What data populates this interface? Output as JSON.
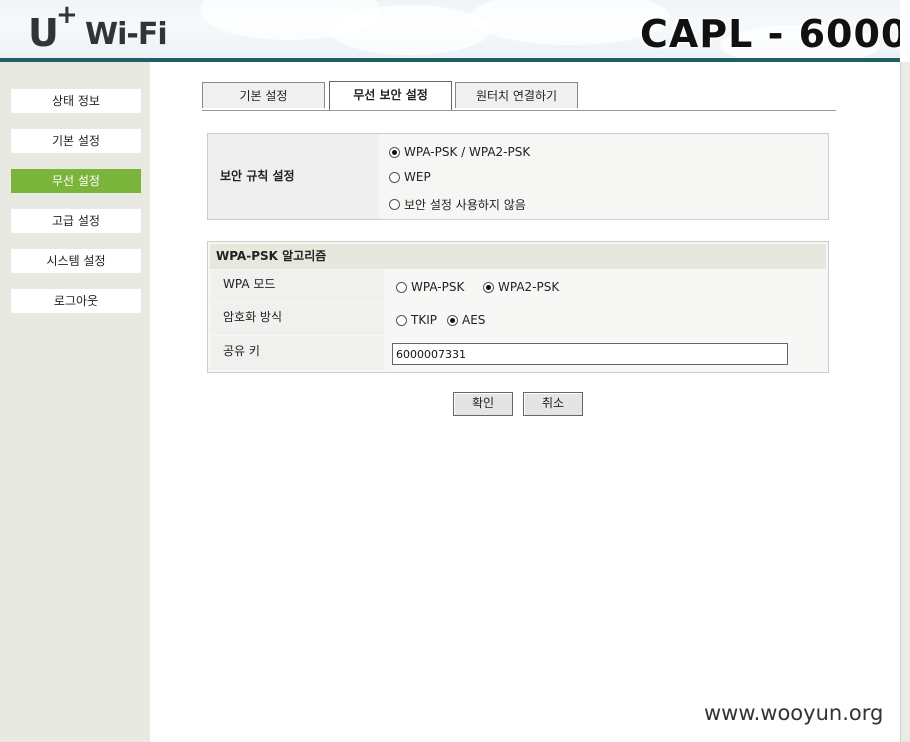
{
  "header": {
    "logo_u": "U",
    "logo_plus": "+",
    "logo_wifi": "Wi-Fi",
    "model_title": "CAPL - 6000"
  },
  "sidebar": {
    "items": [
      {
        "label": "상태 정보",
        "active": false
      },
      {
        "label": "기본 설정",
        "active": false
      },
      {
        "label": "무선 설정",
        "active": true
      },
      {
        "label": "고급 설정",
        "active": false
      },
      {
        "label": "시스템 설정",
        "active": false
      },
      {
        "label": "로그아웃",
        "active": false
      }
    ]
  },
  "tabs": [
    {
      "label": "기본 설정",
      "active": false
    },
    {
      "label": "무선 보안 설정",
      "active": true
    },
    {
      "label": "원터치 연결하기",
      "active": false
    }
  ],
  "security_rule": {
    "label": "보안 규칙 설정",
    "options": [
      {
        "label": "WPA-PSK / WPA2-PSK",
        "selected": true
      },
      {
        "label": "WEP",
        "selected": false
      },
      {
        "label": "보안 설정 사용하지 않음",
        "selected": false
      }
    ]
  },
  "algorithm": {
    "heading": "WPA-PSK 알고리즘",
    "wpa_mode": {
      "label": "WPA 모드",
      "options": [
        {
          "label": "WPA-PSK",
          "selected": false
        },
        {
          "label": "WPA2-PSK",
          "selected": true
        }
      ]
    },
    "encryption": {
      "label": "암호화 방식",
      "options": [
        {
          "label": "TKIP",
          "selected": false
        },
        {
          "label": "AES",
          "selected": true
        }
      ]
    },
    "shared_key": {
      "label": "공유 키",
      "value": "6000007331"
    }
  },
  "buttons": {
    "confirm": "확인",
    "cancel": "취소"
  },
  "watermark": "www.wooyun.org",
  "colors": {
    "active_green": "#7ab43a",
    "header_bar": "#1f5f66",
    "sidebar_bg": "#e8eae2"
  }
}
